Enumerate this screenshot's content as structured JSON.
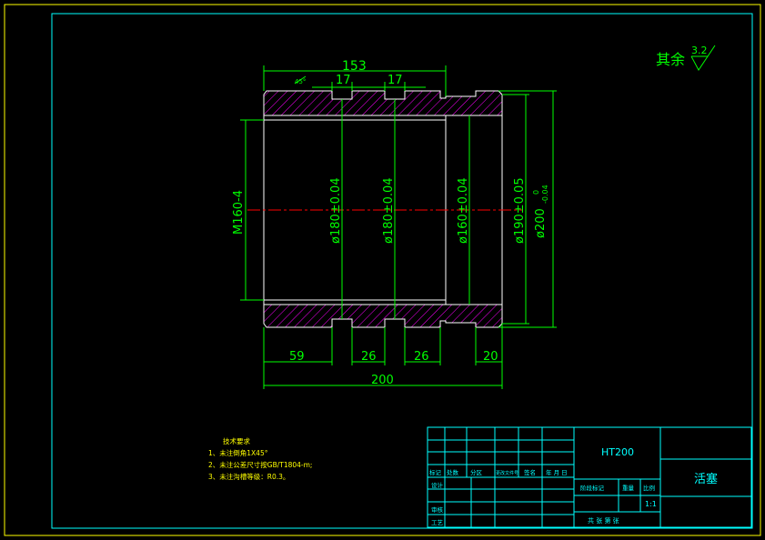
{
  "drawing": {
    "roughness": {
      "label": "其余",
      "value": "3.2"
    },
    "dimensions": {
      "overall_top": "153",
      "groove1_width": "17",
      "groove2_width": "17",
      "chamfer": "45°",
      "thread": "M160-4",
      "dia1": "ø180±0.04",
      "dia2": "ø180±0.04",
      "dia3": "ø160±0.04",
      "dia4": "ø190±0.05",
      "dia5_base": "ø200",
      "dia5_upper": "0",
      "dia5_lower": "-0.04",
      "len_59": "59",
      "len_26a": "26",
      "len_26b": "26",
      "len_20": "20",
      "overall_bottom": "200"
    },
    "notes": {
      "title": "技术要求",
      "items": [
        "1、未注倒角1X45°",
        "2、未注公差尺寸按GB/T1804-m;",
        "3、未注沟槽等级：R0.3。"
      ]
    }
  },
  "title_block": {
    "material": "HT200",
    "part_name": "活塞",
    "scale": "1:1",
    "row_labels": [
      "标记",
      "处数",
      "分区",
      "更改文件号",
      "签名",
      "年 月 日"
    ],
    "stage_label": "阶段标记",
    "weight_label": "重量",
    "scale_label": "比例",
    "design": "设计",
    "review": "审核",
    "process": "工艺",
    "sheet_text": "共  张  第  张"
  }
}
